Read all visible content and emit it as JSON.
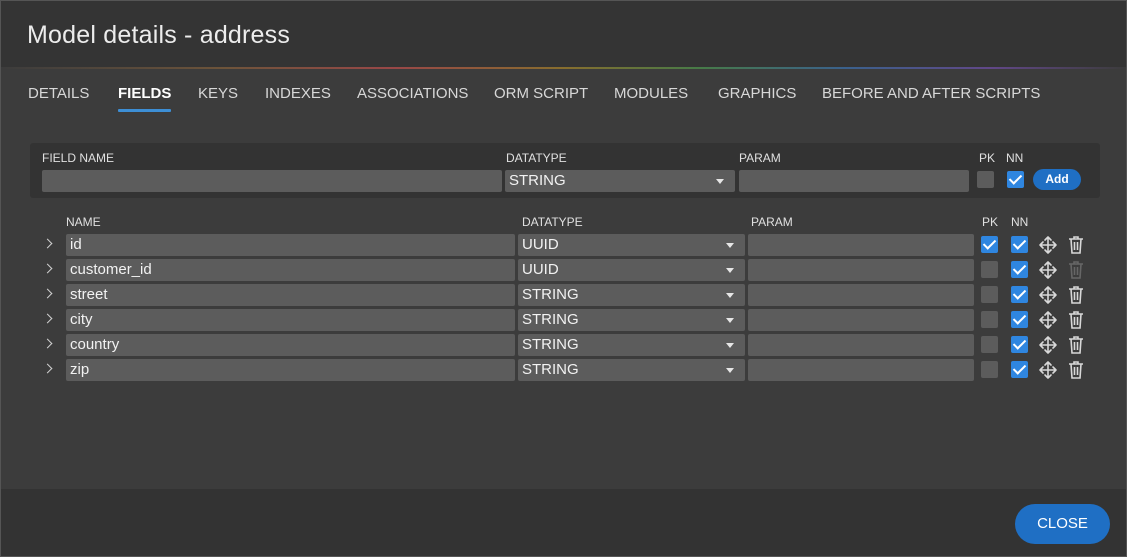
{
  "dialog": {
    "title": "Model details - address"
  },
  "tabs": [
    {
      "label": "DETAILS"
    },
    {
      "label": "FIELDS"
    },
    {
      "label": "KEYS"
    },
    {
      "label": "INDEXES"
    },
    {
      "label": "ASSOCIATIONS"
    },
    {
      "label": "ORM SCRIPT"
    },
    {
      "label": "MODULES"
    },
    {
      "label": "GRAPHICS"
    },
    {
      "label": "BEFORE AND AFTER SCRIPTS"
    }
  ],
  "active_tab": "FIELDS",
  "new_field": {
    "field_name_label": "FIELD NAME",
    "datatype_label": "DATATYPE",
    "param_label": "PARAM",
    "pk_label": "PK",
    "nn_label": "NN",
    "field_name_value": "",
    "datatype_value": "STRING",
    "param_value": "",
    "pk_checked": false,
    "nn_checked": true,
    "add_label": "Add"
  },
  "grid": {
    "headers": {
      "name": "NAME",
      "datatype": "DATATYPE",
      "param": "PARAM",
      "pk": "PK",
      "nn": "NN"
    },
    "rows": [
      {
        "name": "id",
        "datatype": "UUID",
        "param": "",
        "pk": true,
        "nn": true,
        "delete_enabled": true
      },
      {
        "name": "customer_id",
        "datatype": "UUID",
        "param": "",
        "pk": false,
        "nn": true,
        "delete_enabled": false
      },
      {
        "name": "street",
        "datatype": "STRING",
        "param": "",
        "pk": false,
        "nn": true,
        "delete_enabled": true
      },
      {
        "name": "city",
        "datatype": "STRING",
        "param": "",
        "pk": false,
        "nn": true,
        "delete_enabled": true
      },
      {
        "name": "country",
        "datatype": "STRING",
        "param": "",
        "pk": false,
        "nn": true,
        "delete_enabled": true
      },
      {
        "name": "zip",
        "datatype": "STRING",
        "param": "",
        "pk": false,
        "nn": true,
        "delete_enabled": true
      }
    ]
  },
  "footer": {
    "close_label": "CLOSE"
  },
  "colors": {
    "accent": "#1f6fc4",
    "checkbox_on": "#2f86e0",
    "tab_underline": "#3d8fd6"
  },
  "icons": {
    "expand": "chevron-right-icon",
    "move": "move-arrows-icon",
    "delete": "trash-icon",
    "select_caret": "caret-down-icon"
  }
}
